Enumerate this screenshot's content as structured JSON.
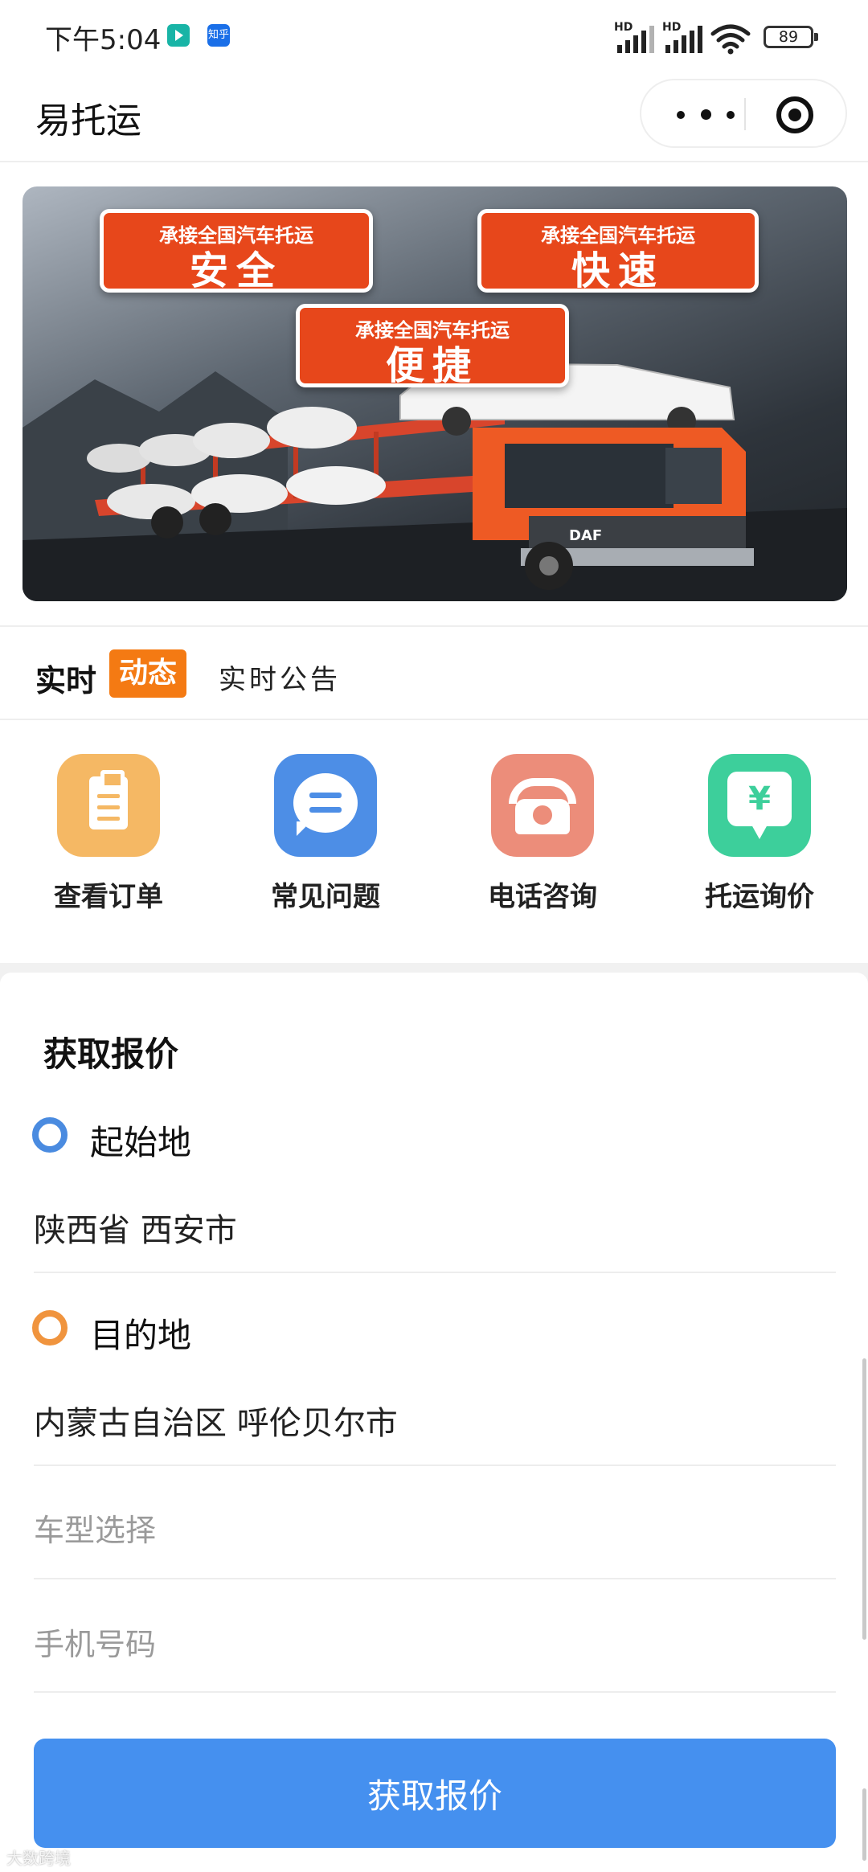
{
  "status_bar": {
    "time": "下午5:04",
    "app_badge_zhihu": "知乎",
    "signal1_label": "HD",
    "signal2_label": "HD",
    "battery": "89"
  },
  "nav": {
    "title": "易托运"
  },
  "banner": {
    "tags": [
      {
        "small": "承接全国汽车托运",
        "big": "安全"
      },
      {
        "small": "承接全国汽车托运",
        "big": "快速"
      },
      {
        "small": "承接全国汽车托运",
        "big": "便捷"
      }
    ],
    "truck_brand": "DAF"
  },
  "news": {
    "label_part1": "实时",
    "label_part2": "动态",
    "text": "实时公告"
  },
  "quick_actions": [
    {
      "label": "查看订单",
      "icon": "clipboard-icon",
      "color": "#f5b864"
    },
    {
      "label": "常见问题",
      "icon": "chat-bubble-icon",
      "color": "#4d8ee6"
    },
    {
      "label": "电话咨询",
      "icon": "telephone-icon",
      "color": "#ec8d7a"
    },
    {
      "label": "托运询价",
      "icon": "yen-bubble-icon",
      "color": "#3dcf9b"
    }
  ],
  "price_glyph": "¥",
  "quote_form": {
    "title": "获取报价",
    "origin_label": "起始地",
    "origin_value": "陕西省 西安市",
    "destination_label": "目的地",
    "destination_value": "内蒙古自治区 呼伦贝尔市",
    "car_type_placeholder": "车型选择",
    "phone_placeholder": "手机号码",
    "submit_label": "获取报价"
  },
  "watermark": "大数跨境",
  "colors": {
    "accent_blue": "#4590ef",
    "news_orange": "#f47a13",
    "origin_dot": "#4a8be0",
    "destination_dot": "#f0943e"
  }
}
